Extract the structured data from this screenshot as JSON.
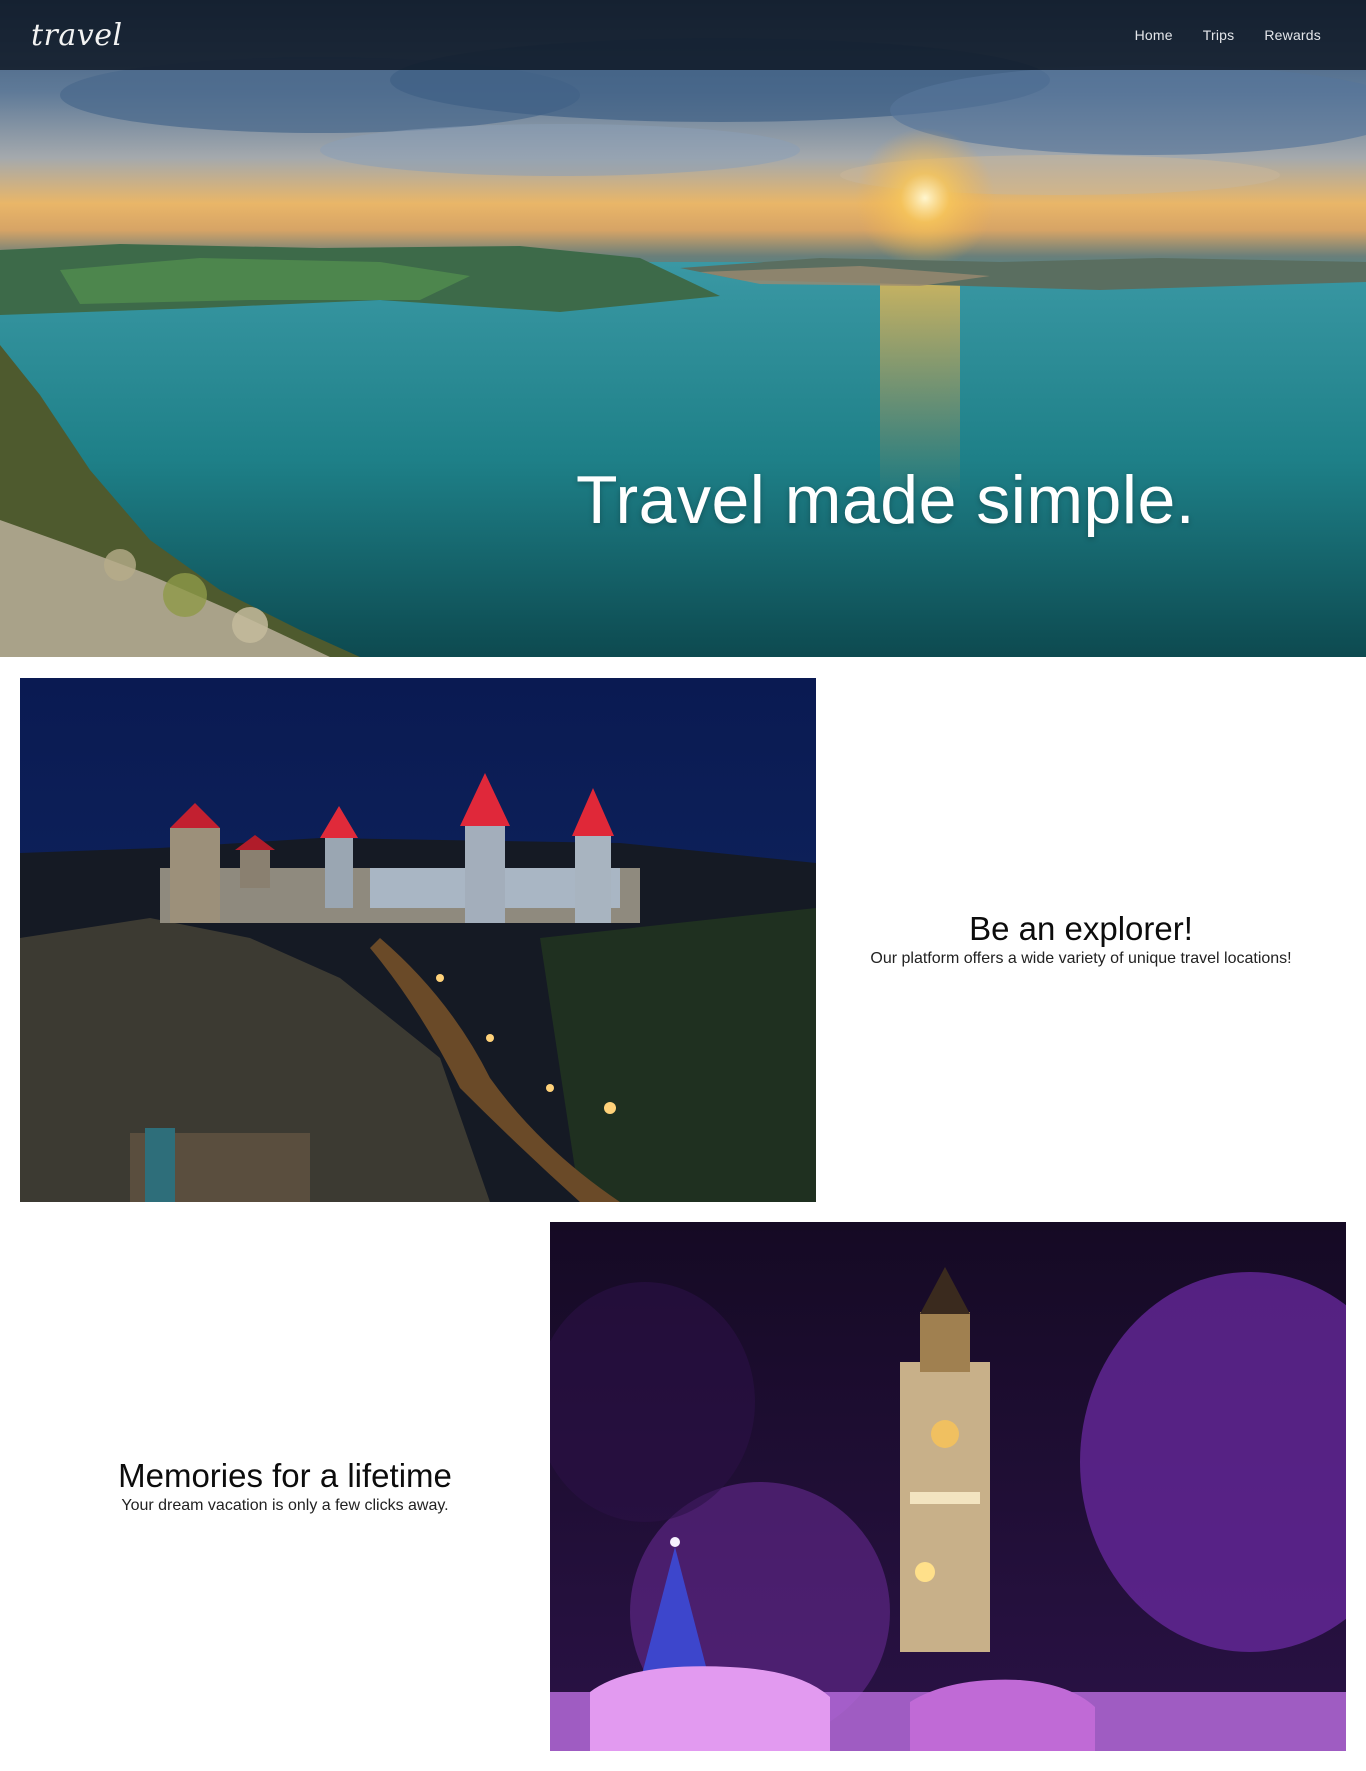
{
  "nav": {
    "brand": "travel",
    "links": [
      {
        "label": "Home"
      },
      {
        "label": "Trips"
      },
      {
        "label": "Rewards"
      }
    ]
  },
  "hero": {
    "headline": "Travel made simple."
  },
  "features": [
    {
      "title": "Be an explorer!",
      "description": "Our platform offers a wide variety of unique travel locations!"
    },
    {
      "title": "Memories for a lifetime",
      "description": "Your dream vacation is only a few clicks away."
    }
  ],
  "colors": {
    "navbar": "#0a121e",
    "nav_text": "#e4e6ea",
    "heading_text": "#0c0c0c",
    "lake": "#1f8087",
    "sunset": "#f2b04a"
  }
}
